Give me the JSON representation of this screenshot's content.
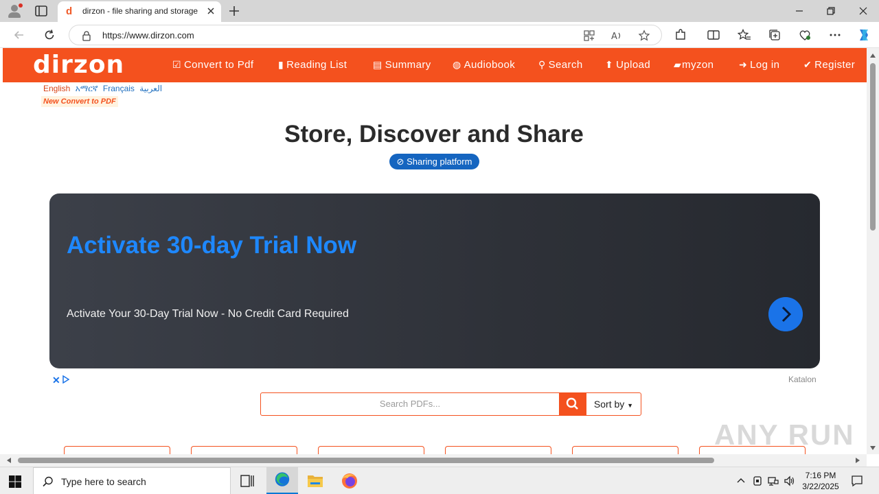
{
  "browser": {
    "tab_title": "dirzon - file sharing and storage",
    "favicon_letter": "d",
    "url": "https://www.dirzon.com"
  },
  "site": {
    "logo": "dirzon",
    "brand_color": "#f4511e",
    "nav": [
      {
        "label": "Convert to Pdf",
        "icon": "check-square-icon"
      },
      {
        "label": "Reading List",
        "icon": "bar-chart-icon"
      },
      {
        "label": "Summary",
        "icon": "list-icon"
      },
      {
        "label": "Audiobook",
        "icon": "globe-icon"
      },
      {
        "label": "Search",
        "icon": "search-icon"
      },
      {
        "label": "Upload",
        "icon": "upload-icon"
      },
      {
        "label": "myzon",
        "icon": "folder-icon"
      },
      {
        "label": "Log in",
        "icon": "login-icon"
      },
      {
        "label": "Register",
        "icon": "check-circle-icon"
      }
    ],
    "languages": [
      "English",
      "አማርኛ",
      "Français",
      "العربية"
    ],
    "new_convert": "New Convert to PDF",
    "hero_title": "Store, Discover and Share",
    "badge": "Sharing platform",
    "ad": {
      "title": "Activate 30-day Trial Now",
      "subtitle": "Activate Your 30-Day Trial Now - No Credit Card Required",
      "brand": "Katalon"
    },
    "search": {
      "placeholder": "Search PDFs...",
      "sort_label": "Sort by"
    }
  },
  "watermark": "ANY RUN",
  "taskbar": {
    "search_placeholder": "Type here to search",
    "time": "7:16 PM",
    "date": "3/22/2025"
  }
}
